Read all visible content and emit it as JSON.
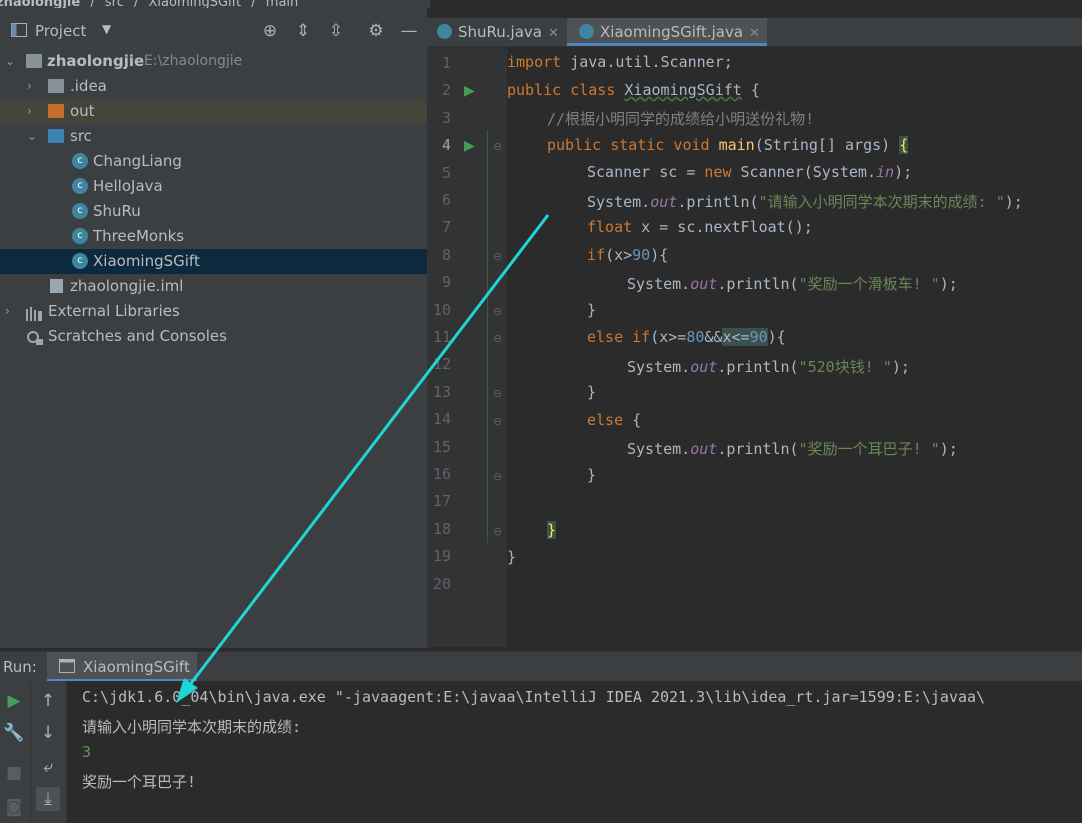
{
  "breadcrumb": [
    "zhaolongjie",
    "src",
    "XiaomingSGift",
    "main"
  ],
  "project_panel": {
    "title": "Project",
    "tree": [
      {
        "label": "zhaolongjie",
        "path": "E:\\zhaolongjie",
        "type": "module",
        "expanded": true
      },
      {
        "label": ".idea",
        "type": "folder",
        "expanded": false
      },
      {
        "label": "out",
        "type": "folder-excluded",
        "expanded": false
      },
      {
        "label": "src",
        "type": "folder-source",
        "expanded": true
      },
      {
        "label": "ChangLiang",
        "type": "class"
      },
      {
        "label": "HelloJava",
        "type": "class"
      },
      {
        "label": "ShuRu",
        "type": "class"
      },
      {
        "label": "ThreeMonks",
        "type": "class"
      },
      {
        "label": "XiaomingSGift",
        "type": "class",
        "selected": true
      },
      {
        "label": "zhaolongjie.iml",
        "type": "file"
      },
      {
        "label": "External Libraries",
        "type": "library"
      },
      {
        "label": "Scratches and Consoles",
        "type": "scratches"
      }
    ]
  },
  "editor": {
    "tabs": [
      {
        "label": "ShuRu.java",
        "active": false
      },
      {
        "label": "XiaomingSGift.java",
        "active": true
      }
    ],
    "line_numbers": [
      "1",
      "2",
      "3",
      "4",
      "5",
      "6",
      "7",
      "8",
      "9",
      "10",
      "11",
      "12",
      "13",
      "14",
      "15",
      "16",
      "17",
      "18",
      "19",
      "20"
    ],
    "code": {
      "l1_kw": "import",
      "l1_rest": " java.util.Scanner;",
      "l2_kw": "public class",
      "l2_cls": "XiaomingSGift",
      "l2_rest": " {",
      "l3": "//根据小明同学的成绩给小明送份礼物!",
      "l4_kw": "public static void",
      "l4_fn": "main",
      "l4_args": "(String[] args) ",
      "l4_brace": "{",
      "l5_a": "Scanner sc = ",
      "l5_kw": "new",
      "l5_b": " Scanner(System.",
      "l5_fld": "in",
      "l5_c": ");",
      "l6_a": "System.",
      "l6_fld": "out",
      "l6_b": ".println(",
      "l6_str": "\"请输入小明同学本次期末的成绩: \"",
      "l6_c": ");",
      "l7_kw": "float",
      "l7_rest": " x = sc.nextFloat();",
      "l8_kw": "if",
      "l8_a": "(x>",
      "l8_num": "90",
      "l8_b": "){",
      "l9_a": "System.",
      "l9_fld": "out",
      "l9_b": ".println(",
      "l9_str": "\"奖励一个滑板车! \"",
      "l9_c": ");",
      "l10": "}",
      "l11_kw": "else if",
      "l11_a": "(x>=",
      "l11_num1": "80",
      "l11_b": "&&",
      "l11_hl": "x<=",
      "l11_num2": "90",
      "l11_c": "){",
      "l12_a": "System.",
      "l12_fld": "out",
      "l12_b": ".println(",
      "l12_str": "\"520块钱! \"",
      "l12_c": ");",
      "l13": "}",
      "l14_kw": "else",
      "l14_rest": " {",
      "l15_a": "System.",
      "l15_fld": "out",
      "l15_b": ".println(",
      "l15_str": "\"奖励一个耳巴子! \"",
      "l15_c": ");",
      "l16": "}",
      "l18": "}",
      "l19": "}"
    }
  },
  "run_panel": {
    "label": "Run:",
    "tab": "XiaomingSGift",
    "output": [
      "C:\\jdk1.6.0_04\\bin\\java.exe \"-javaagent:E:\\javaa\\IntelliJ IDEA 2021.3\\lib\\idea_rt.jar=1599:E:\\javaa\\",
      "请输入小明同学本次期末的成绩:",
      "3",
      "奖励一个耳巴子!"
    ]
  },
  "colors": {
    "accent": "#4a88c7",
    "annotation_arrow": "#1fd6d6",
    "input_text": "#629755"
  }
}
